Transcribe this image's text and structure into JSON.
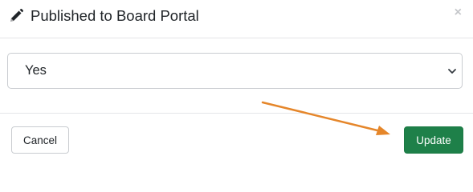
{
  "modal": {
    "title": "Published to Board Portal",
    "title_icon": "pencil-icon",
    "close_icon": "close-icon",
    "close_glyph": "×"
  },
  "field": {
    "selected_value": "Yes",
    "chevron_icon": "chevron-down-icon"
  },
  "footer": {
    "cancel_label": "Cancel",
    "update_label": "Update"
  },
  "colors": {
    "primary_button": "#1e8049",
    "annotation_arrow": "#e5862a"
  }
}
